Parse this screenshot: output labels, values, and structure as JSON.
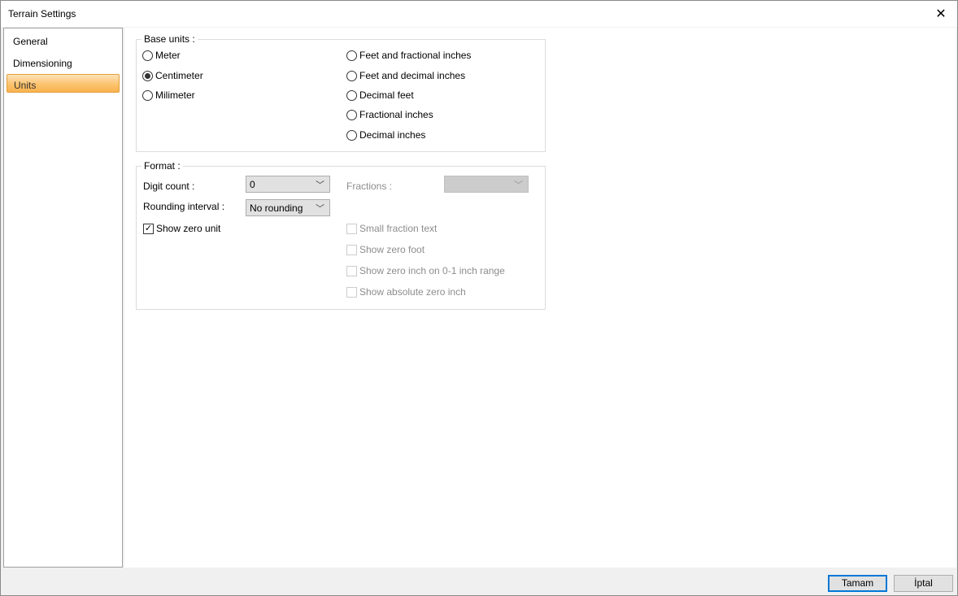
{
  "window": {
    "title": "Terrain Settings"
  },
  "sidebar": {
    "items": [
      {
        "label": "General"
      },
      {
        "label": "Dimensioning"
      },
      {
        "label": "Units"
      }
    ]
  },
  "base_units": {
    "legend": "Base units :",
    "metric": [
      "Meter",
      "Centimeter",
      "Milimeter"
    ],
    "imperial": [
      "Feet and fractional inches",
      "Feet and decimal inches",
      "Decimal feet",
      "Fractional inches",
      "Decimal inches"
    ],
    "selected": "Centimeter"
  },
  "format": {
    "legend": "Format :",
    "digit_count_label": "Digit count :",
    "digit_count_value": "0",
    "rounding_label": "Rounding interval :",
    "rounding_value": "No rounding",
    "fractions_label": "Fractions :",
    "fractions_value": "",
    "show_zero_unit": "Show zero unit",
    "disabled_options": [
      "Small fraction text",
      "Show zero foot",
      "Show zero inch on 0-1 inch range",
      "Show absolute zero inch"
    ]
  },
  "footer": {
    "ok": "Tamam",
    "cancel": "İptal"
  }
}
